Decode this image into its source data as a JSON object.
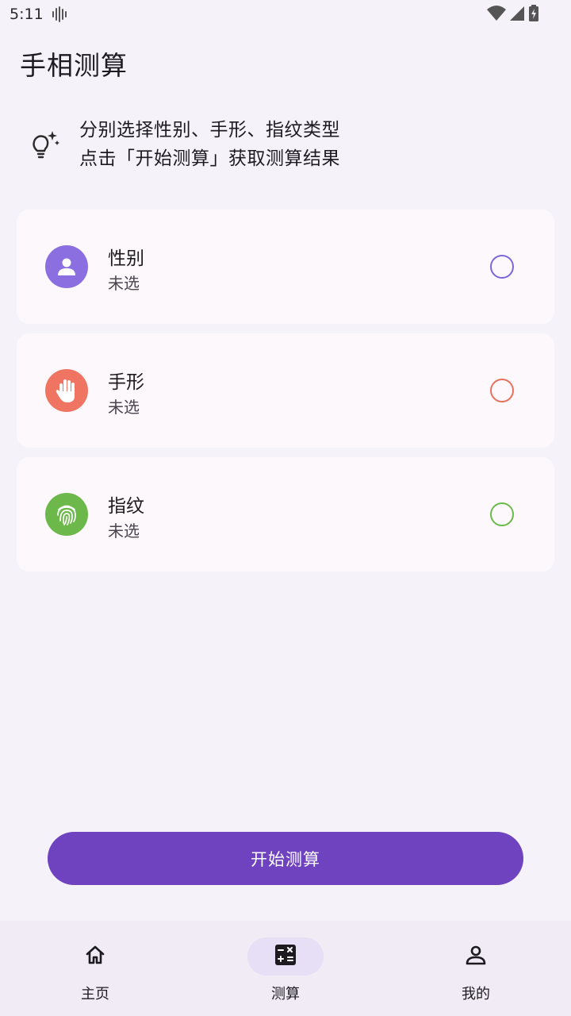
{
  "status_bar": {
    "time": "5:11"
  },
  "app_title": "手相测算",
  "tip": {
    "line1": "分别选择性别、手形、指纹类型",
    "line2": "点击「开始测算」获取测算结果"
  },
  "cards": [
    {
      "title": "性别",
      "subtitle": "未选",
      "icon": "person-icon",
      "color": "#8b6fe0",
      "radio_color": "#7b68d8"
    },
    {
      "title": "手形",
      "subtitle": "未选",
      "icon": "hand-icon",
      "color": "#ef7461",
      "radio_color": "#e8705e"
    },
    {
      "title": "指纹",
      "subtitle": "未选",
      "icon": "fingerprint-icon",
      "color": "#6cb84a",
      "radio_color": "#6cb84a"
    }
  ],
  "start_button": {
    "label": "开始测算",
    "color": "#6f42bf"
  },
  "bottom_nav": {
    "items": [
      {
        "label": "主页",
        "icon": "home-icon",
        "active": false
      },
      {
        "label": "测算",
        "icon": "calculator-icon",
        "active": true
      },
      {
        "label": "我的",
        "icon": "profile-icon",
        "active": false
      }
    ]
  }
}
